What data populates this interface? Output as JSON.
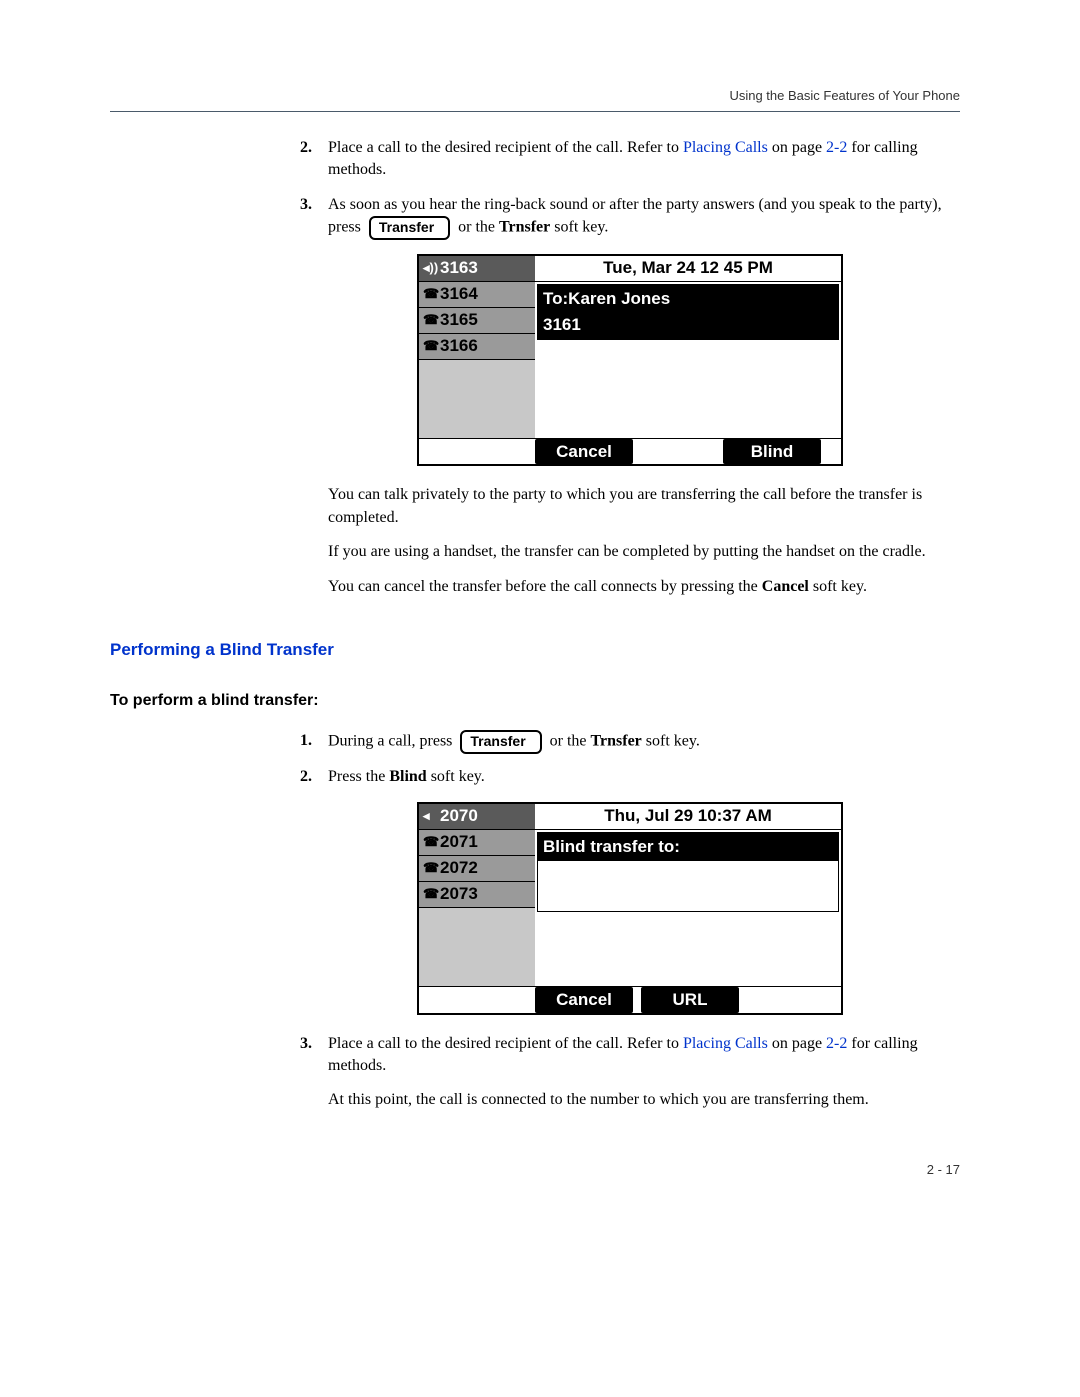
{
  "header": "Using the Basic Features of Your Phone",
  "steps_a": {
    "s2": {
      "num": "2.",
      "t1": "Place a call to the desired recipient of the call. Refer to ",
      "link": "Placing Calls",
      "t2": " on page ",
      "pageref": "2-2",
      "t3": " for calling methods."
    },
    "s3": {
      "num": "3.",
      "t1": "As soon as you hear the ring-back sound or after the party answers (and you speak to the party), press ",
      "btn": "Transfer",
      "t2": " or the ",
      "bold": "Trnsfer",
      "t3": " soft key."
    }
  },
  "screen1": {
    "side": [
      "3163",
      "3164",
      "3165",
      "3166"
    ],
    "datetime": "Tue, Mar 24  12 45 PM",
    "row1": "To:Karen Jones",
    "row2": "3161",
    "sk1": "Cancel",
    "sk2": "Blind"
  },
  "after1": {
    "p1": "You can talk privately to the party to which you are transferring the call before the transfer is completed.",
    "p2": "If you are using a handset, the transfer can be completed by putting the handset on the cradle.",
    "p3a": "You can cancel the transfer before the call connects by pressing the ",
    "p3b": "Cancel",
    "p3c": " soft key."
  },
  "heading_blind": "Performing a Blind Transfer",
  "subheading_blind": "To perform a blind transfer:",
  "steps_b": {
    "s1": {
      "num": "1.",
      "t1": "During a call, press ",
      "btn": "Transfer",
      "t2": " or the ",
      "bold": "Trnsfer",
      "t3": " soft key."
    },
    "s2": {
      "num": "2.",
      "t1": "Press the ",
      "bold": "Blind",
      "t2": " soft key."
    },
    "s3": {
      "num": "3.",
      "t1": "Place a call to the desired recipient of the call. Refer to ",
      "link": "Placing Calls",
      "t2": " on page ",
      "pageref": "2-2",
      "t3": " for calling methods."
    }
  },
  "screen2": {
    "side": [
      "2070",
      "2071",
      "2072",
      "2073"
    ],
    "datetime": "Thu, Jul 29  10:37 AM",
    "row1": "Blind transfer to:",
    "sk1": "Cancel",
    "sk2": "URL"
  },
  "after2": {
    "p1": "At this point, the call is connected to the number to which you are transferring them."
  },
  "page_num": "2 - 17"
}
